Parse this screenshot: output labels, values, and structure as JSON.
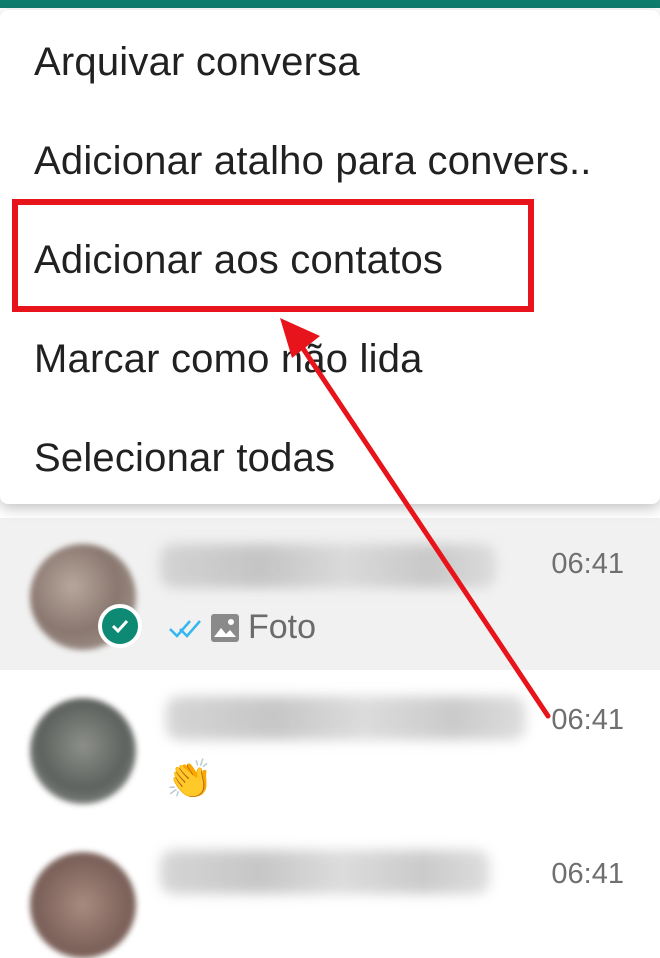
{
  "context_menu": {
    "items": [
      {
        "label": "Arquivar conversa"
      },
      {
        "label": "Adicionar atalho para convers.."
      },
      {
        "label": "Adicionar aos contatos"
      },
      {
        "label": "Marcar como não lida"
      },
      {
        "label": "Selecionar todas"
      }
    ],
    "highlighted_item": "Adicionar aos contatos"
  },
  "chats": [
    {
      "time": "06:41",
      "preview": "Foto",
      "selected": true,
      "status": "read-double-check",
      "preview_icon": "image-icon"
    },
    {
      "time": "06:41",
      "preview": "👏"
    },
    {
      "time": "06:41"
    }
  ],
  "colors": {
    "accent": "#0f7d6e",
    "annotation_red": "#e8141b",
    "read_check": "#34b7f1"
  }
}
